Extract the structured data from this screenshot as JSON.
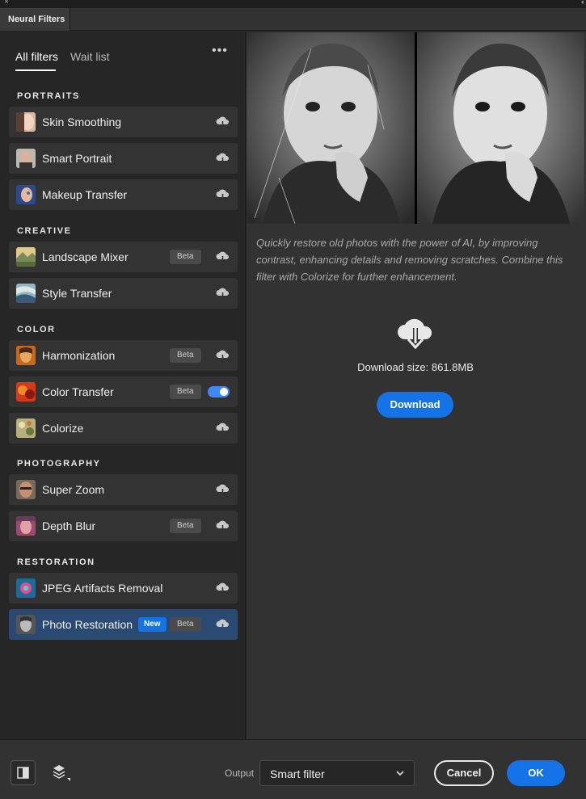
{
  "window": {
    "close_glyph": "×",
    "collapse_glyph": "‹‹",
    "tab_title": "Neural Filters"
  },
  "sidebar": {
    "tabs": [
      {
        "label": "All filters",
        "active": true
      },
      {
        "label": "Wait list",
        "active": false
      }
    ],
    "more_label": "•••",
    "categories": [
      {
        "title": "PORTRAITS"
      },
      {
        "title": "CREATIVE"
      },
      {
        "title": "COLOR"
      },
      {
        "title": "PHOTOGRAPHY"
      },
      {
        "title": "RESTORATION"
      }
    ],
    "filters": [
      {
        "label": "Skin Smoothing",
        "badges": [],
        "state": "cloud",
        "thumb_icon": "skin-smoothing-thumb"
      },
      {
        "label": "Smart Portrait",
        "badges": [],
        "state": "cloud",
        "thumb_icon": "smart-portrait-thumb"
      },
      {
        "label": "Makeup Transfer",
        "badges": [],
        "state": "cloud",
        "thumb_icon": "makeup-transfer-thumb"
      },
      {
        "label": "Landscape Mixer",
        "badges": [
          "Beta"
        ],
        "state": "cloud",
        "thumb_icon": "landscape-mixer-thumb"
      },
      {
        "label": "Style Transfer",
        "badges": [],
        "state": "cloud",
        "thumb_icon": "style-transfer-thumb"
      },
      {
        "label": "Harmonization",
        "badges": [
          "Beta"
        ],
        "state": "cloud",
        "thumb_icon": "harmonization-thumb"
      },
      {
        "label": "Color Transfer",
        "badges": [
          "Beta"
        ],
        "state": "toggle-on",
        "thumb_icon": "color-transfer-thumb"
      },
      {
        "label": "Colorize",
        "badges": [],
        "state": "cloud",
        "thumb_icon": "colorize-thumb"
      },
      {
        "label": "Super Zoom",
        "badges": [],
        "state": "cloud",
        "thumb_icon": "super-zoom-thumb"
      },
      {
        "label": "Depth Blur",
        "badges": [
          "Beta"
        ],
        "state": "cloud",
        "thumb_icon": "depth-blur-thumb"
      },
      {
        "label": "JPEG Artifacts Removal",
        "badges": [],
        "state": "cloud",
        "thumb_icon": "jpeg-artifacts-thumb"
      },
      {
        "label": "Photo Restoration",
        "badges": [
          "New",
          "Beta"
        ],
        "state": "cloud",
        "selected": true,
        "thumb_icon": "photo-restoration-thumb"
      }
    ]
  },
  "main": {
    "description": "Quickly restore old photos with the power of AI, by improving contrast, enhancing details and removing scratches. Combine this filter with Colorize for further enhancement.",
    "download_size": "Download size: 861.8MB",
    "download_label": "Download"
  },
  "footer": {
    "output_label": "Output",
    "output_value": "Smart filter",
    "cancel_label": "Cancel",
    "ok_label": "OK"
  },
  "colors": {
    "accent": "#1473e6",
    "selected_item": "#2b4a73",
    "toggle_on": "#3d8af7"
  }
}
